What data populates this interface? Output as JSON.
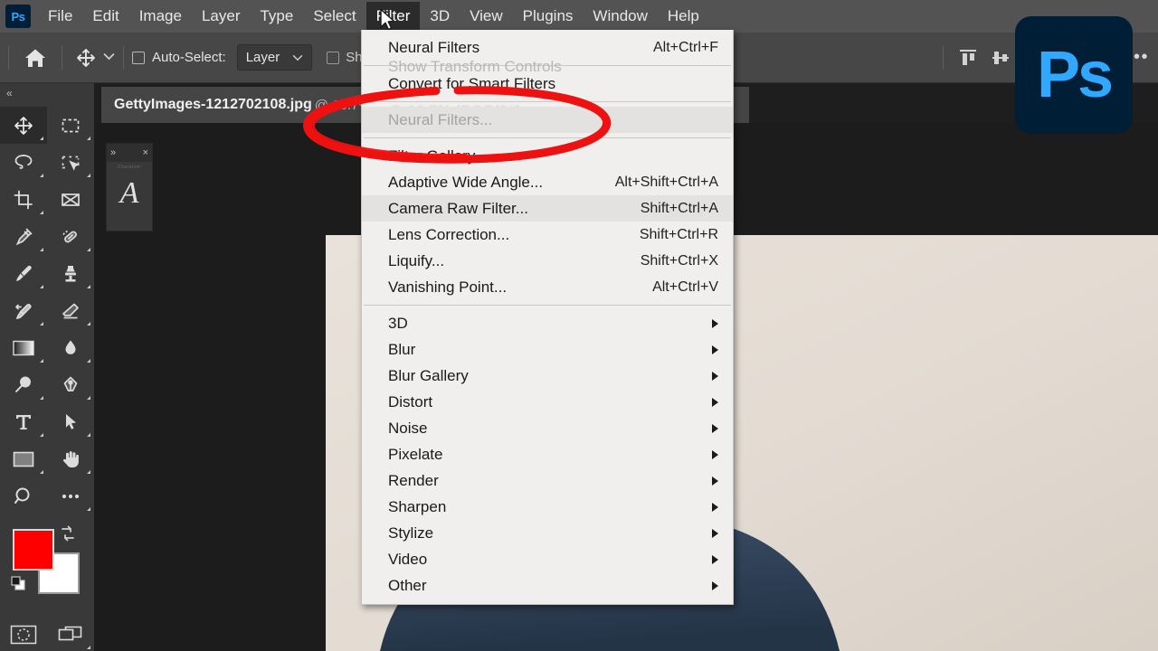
{
  "app": {
    "name": "Adobe Photoshop",
    "logo_text": "Ps",
    "accent_color": "#31a8ff",
    "logo_bg": "#001e36"
  },
  "menubar": {
    "logo_icon": "photoshop-logo-icon",
    "items": [
      {
        "label": "File",
        "active": false
      },
      {
        "label": "Edit",
        "active": false
      },
      {
        "label": "Image",
        "active": false
      },
      {
        "label": "Layer",
        "active": false
      },
      {
        "label": "Type",
        "active": false
      },
      {
        "label": "Select",
        "active": false
      },
      {
        "label": "Filter",
        "active": true
      },
      {
        "label": "3D",
        "active": false
      },
      {
        "label": "View",
        "active": false
      },
      {
        "label": "Plugins",
        "active": false
      },
      {
        "label": "Window",
        "active": false
      },
      {
        "label": "Help",
        "active": false
      }
    ]
  },
  "options_bar": {
    "home_icon": "home-icon",
    "move_tool_icon": "move-tool-icon",
    "tool_preset_chevron": "chevron-down-icon",
    "auto_select_label": "Auto-Select:",
    "auto_select_checked": false,
    "layer_dropdown_value": "Layer",
    "layer_dropdown_chevron": "chevron-down-icon",
    "show_transform_label": "Show Transform Controls",
    "show_transform_checked": false,
    "align_icons": [
      "align-top-edges-icon",
      "align-vertical-centers-icon",
      "align-bottom-edges-icon",
      "distribute-horizontal-centers-icon"
    ],
    "more_label": "•••"
  },
  "toolbar": {
    "collapse_label": "«",
    "tools": [
      {
        "name": "move-tool",
        "selected": true,
        "flyout": true
      },
      {
        "name": "rectangular-marquee-tool",
        "selected": false,
        "flyout": true
      },
      {
        "name": "lasso-tool",
        "selected": false,
        "flyout": true
      },
      {
        "name": "object-selection-tool",
        "selected": false,
        "flyout": true
      },
      {
        "name": "crop-tool",
        "selected": false,
        "flyout": true
      },
      {
        "name": "frame-tool",
        "selected": false,
        "flyout": false
      },
      {
        "name": "eyedropper-tool",
        "selected": false,
        "flyout": true
      },
      {
        "name": "spot-healing-brush-tool",
        "selected": false,
        "flyout": true
      },
      {
        "name": "brush-tool",
        "selected": false,
        "flyout": true
      },
      {
        "name": "clone-stamp-tool",
        "selected": false,
        "flyout": true
      },
      {
        "name": "history-brush-tool",
        "selected": false,
        "flyout": true
      },
      {
        "name": "eraser-tool",
        "selected": false,
        "flyout": true
      },
      {
        "name": "gradient-tool",
        "selected": false,
        "flyout": true
      },
      {
        "name": "blur-tool",
        "selected": false,
        "flyout": true
      },
      {
        "name": "dodge-tool",
        "selected": false,
        "flyout": true
      },
      {
        "name": "pen-tool",
        "selected": false,
        "flyout": true
      },
      {
        "name": "horizontal-type-tool",
        "selected": false,
        "flyout": true
      },
      {
        "name": "path-selection-tool",
        "selected": false,
        "flyout": true
      },
      {
        "name": "rectangle-tool",
        "selected": false,
        "flyout": true
      },
      {
        "name": "hand-tool",
        "selected": false,
        "flyout": true
      },
      {
        "name": "zoom-tool",
        "selected": false,
        "flyout": false
      },
      {
        "name": "edit-toolbar-tool",
        "selected": false,
        "flyout": true
      }
    ],
    "foreground_color": "#ff0000",
    "background_color": "#ffffff",
    "swap_colors_icon": "swap-colors-icon",
    "default_colors_icon": "default-colors-icon",
    "quick_mask_icon": "quick-mask-icon",
    "screen_mode_icon": "screen-mode-icon"
  },
  "character_panel": {
    "expand_icon": "»",
    "close_icon": "×",
    "tab_label": "Character",
    "glyph": "A"
  },
  "document": {
    "tab_title": "GettyImages-1212702108.jpg",
    "tab_subtitle": "@ 16.7% (RGB/8#)"
  },
  "filter_menu": {
    "ghost_transform_label": "Show Transform Controls",
    "ghost_document_label": "@ 16.7% (RGB/8#)",
    "groups": [
      {
        "items": [
          {
            "label": "Neural Filters",
            "accel": "Alt+Ctrl+F",
            "dim": false,
            "submenu": false,
            "shade": false
          }
        ]
      },
      {
        "items": [
          {
            "label": "Convert for Smart Filters",
            "accel": "",
            "dim": false,
            "submenu": false,
            "shade": false
          }
        ]
      },
      {
        "items": [
          {
            "label": "Neural Filters...",
            "accel": "",
            "dim": true,
            "submenu": false,
            "shade": true
          }
        ]
      },
      {
        "items": [
          {
            "label": "Filter Gallery...",
            "accel": "",
            "dim": false,
            "submenu": false,
            "shade": false
          },
          {
            "label": "Adaptive Wide Angle...",
            "accel": "Alt+Shift+Ctrl+A",
            "dim": false,
            "submenu": false,
            "shade": false
          },
          {
            "label": "Camera Raw Filter...",
            "accel": "Shift+Ctrl+A",
            "dim": false,
            "submenu": false,
            "shade": true
          },
          {
            "label": "Lens Correction...",
            "accel": "Shift+Ctrl+R",
            "dim": false,
            "submenu": false,
            "shade": false
          },
          {
            "label": "Liquify...",
            "accel": "Shift+Ctrl+X",
            "dim": false,
            "submenu": false,
            "shade": false
          },
          {
            "label": "Vanishing Point...",
            "accel": "Alt+Ctrl+V",
            "dim": false,
            "submenu": false,
            "shade": false
          }
        ]
      },
      {
        "items": [
          {
            "label": "3D",
            "accel": "",
            "dim": false,
            "submenu": true,
            "shade": false
          },
          {
            "label": "Blur",
            "accel": "",
            "dim": false,
            "submenu": true,
            "shade": false
          },
          {
            "label": "Blur Gallery",
            "accel": "",
            "dim": false,
            "submenu": true,
            "shade": false
          },
          {
            "label": "Distort",
            "accel": "",
            "dim": false,
            "submenu": true,
            "shade": false
          },
          {
            "label": "Noise",
            "accel": "",
            "dim": false,
            "submenu": true,
            "shade": false
          },
          {
            "label": "Pixelate",
            "accel": "",
            "dim": false,
            "submenu": true,
            "shade": false
          },
          {
            "label": "Render",
            "accel": "",
            "dim": false,
            "submenu": true,
            "shade": false
          },
          {
            "label": "Sharpen",
            "accel": "",
            "dim": false,
            "submenu": true,
            "shade": false
          },
          {
            "label": "Stylize",
            "accel": "",
            "dim": false,
            "submenu": true,
            "shade": false
          },
          {
            "label": "Video",
            "accel": "",
            "dim": false,
            "submenu": true,
            "shade": false
          },
          {
            "label": "Other",
            "accel": "",
            "dim": false,
            "submenu": true,
            "shade": false
          }
        ]
      }
    ]
  },
  "annotation": {
    "shape": "hand-drawn-ellipse",
    "color": "#ee1111",
    "targets": "Neural Filters..."
  },
  "canvas": {
    "photo_description": "Portrait of a smiling bearded man in a navy sweater on a beige background",
    "background_color": "#1c1c1c"
  }
}
